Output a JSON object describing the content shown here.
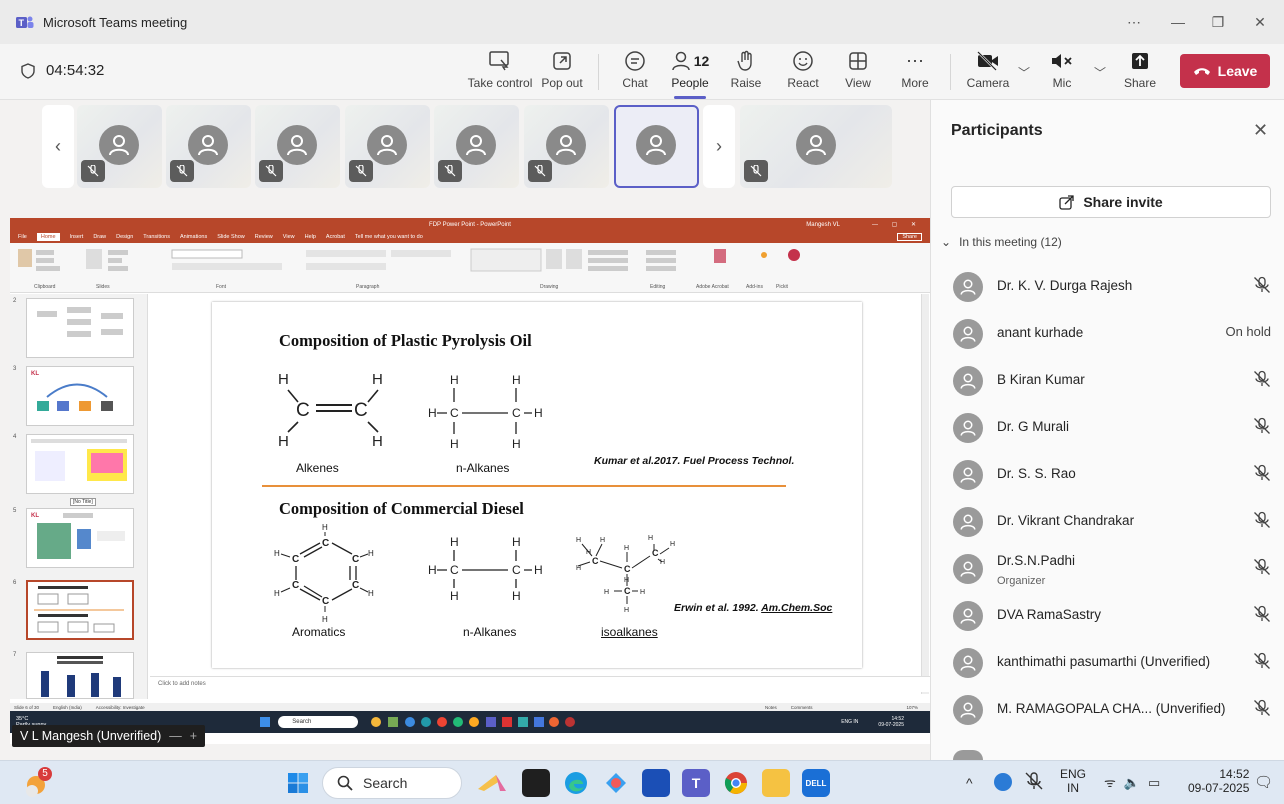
{
  "window": {
    "title": "Microsoft Teams meeting"
  },
  "toolbar": {
    "timer": "04:54:32",
    "take_control": "Take control",
    "pop_out": "Pop out",
    "chat": "Chat",
    "people": "People",
    "people_count": "12",
    "raise": "Raise",
    "react": "React",
    "view": "View",
    "more": "More",
    "camera": "Camera",
    "mic": "Mic",
    "share": "Share",
    "leave": "Leave"
  },
  "share": {
    "pp_title": "FDP Power Point - PowerPoint",
    "pp_user": "Mangesh VL",
    "pp_share": "Share",
    "pp_tabs": [
      "File",
      "Home",
      "Insert",
      "Draw",
      "Design",
      "Transitions",
      "Animations",
      "Slide Show",
      "Review",
      "View",
      "Help",
      "Acrobat",
      "Tell me what you want to do"
    ],
    "ribbon_groups": [
      "Clipboard",
      "Slides",
      "Font",
      "Paragraph",
      "Drawing",
      "Editing",
      "Adobe Acrobat",
      "Add-ins",
      "Pickit"
    ],
    "thumb_numbers": [
      "2",
      "3",
      "4",
      "5",
      "6",
      "7"
    ],
    "thumb_tooltip": "[No Title]",
    "slide": {
      "heading1": "Composition of Plastic Pyrolysis Oil",
      "heading2": "Composition of Commercial Diesel",
      "cap_alkenes": "Alkenes",
      "cap_nalkanes1": "n-Alkanes",
      "ref1": "Kumar et al.2017. Fuel Process Technol.",
      "cap_aromatics": "Aromatics",
      "cap_nalkanes2": "n-Alkanes",
      "cap_isoalkanes": "isoalkanes",
      "ref2_a": "Erwin et al. 1992. ",
      "ref2_b": "Am.Chem.Soc"
    },
    "notes": "Click to add notes",
    "status_left": "Slide 6 of 30",
    "status_lang": "English (India)",
    "status_access": "Accessibility: Investigate",
    "status_notes": "Notes",
    "status_comments": "Comments",
    "status_zoom": "107%",
    "inner_weather": "35°C",
    "inner_weather2": "Partly sunny",
    "inner_search": "Search",
    "inner_lang": "ENG IN",
    "inner_time": "14:52",
    "inner_date": "09-07-2025",
    "presenter": "V L Mangesh (Unverified)"
  },
  "panel": {
    "title": "Participants",
    "invite": "Share invite",
    "section": "In this meeting (12)",
    "participants": [
      {
        "name": "Dr. K. V. Durga Rajesh",
        "role": "",
        "status": "muted"
      },
      {
        "name": "anant kurhade",
        "role": "",
        "status": "On hold"
      },
      {
        "name": "B Kiran Kumar",
        "role": "",
        "status": "muted"
      },
      {
        "name": "Dr. G Murali",
        "role": "",
        "status": "muted"
      },
      {
        "name": "Dr. S. S. Rao",
        "role": "",
        "status": "muted"
      },
      {
        "name": "Dr. Vikrant Chandrakar",
        "role": "",
        "status": "muted"
      },
      {
        "name": "Dr.S.N.Padhi",
        "role": "Organizer",
        "status": "muted"
      },
      {
        "name": "DVA RamaSastry",
        "role": "",
        "status": "muted"
      },
      {
        "name": "kanthimathi pasumarthi (Unverified)",
        "role": "",
        "status": "muted"
      },
      {
        "name": "M. RAMAGOPALA CHA... (Unverified)",
        "role": "",
        "status": "muted"
      }
    ]
  },
  "taskbar": {
    "badge": "5",
    "search": "Search",
    "lang1": "ENG",
    "lang2": "IN",
    "time": "14:52",
    "date": "09-07-2025"
  },
  "colors": {
    "accent": "#5b5fc7",
    "leave": "#c4314b",
    "pp": "#b7472a"
  }
}
